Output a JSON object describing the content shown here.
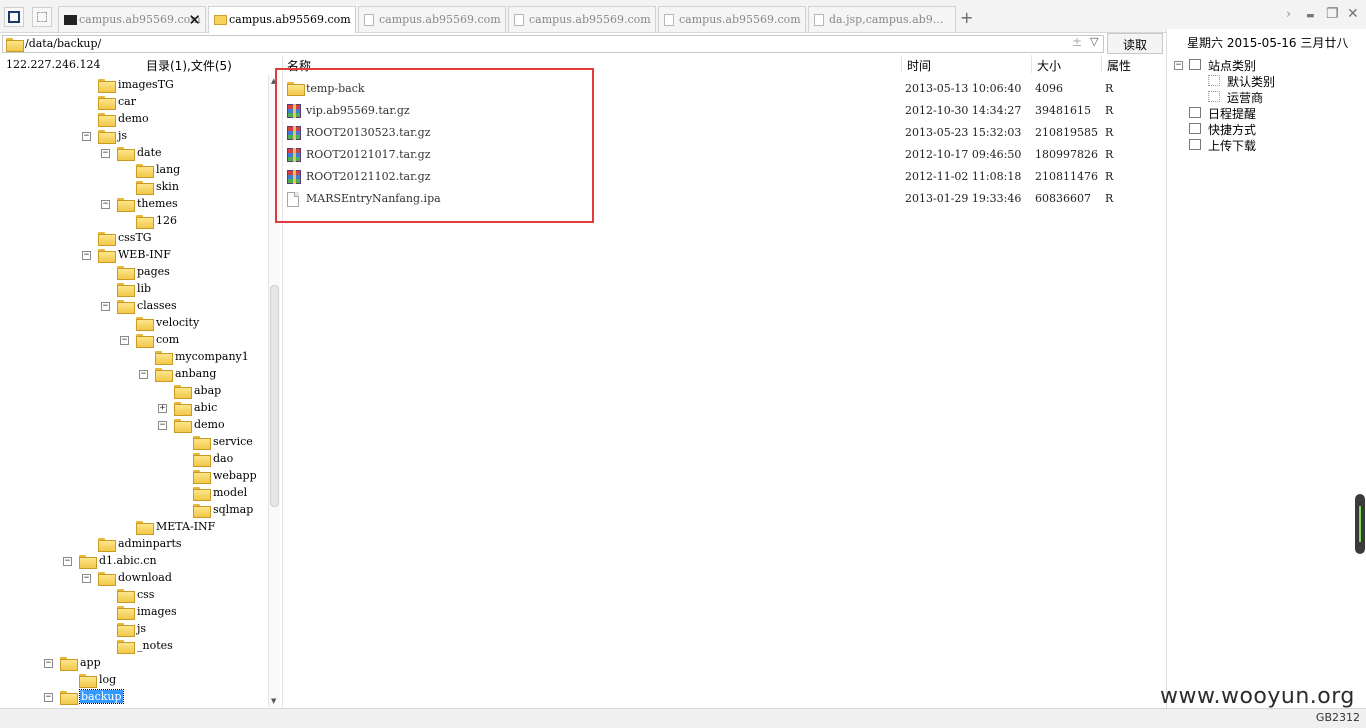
{
  "tabs": [
    {
      "label": "campus.ab95569.com",
      "icon": "terminal-icon",
      "active": false,
      "closable": true
    },
    {
      "label": "campus.ab95569.com",
      "icon": "folder-icon",
      "active": true,
      "closable": false
    },
    {
      "label": "campus.ab95569.com",
      "icon": "page-icon",
      "active": false,
      "closable": false
    },
    {
      "label": "campus.ab95569.com",
      "icon": "page-icon",
      "active": false,
      "closable": false
    },
    {
      "label": "campus.ab95569.com",
      "icon": "page-icon",
      "active": false,
      "closable": false
    },
    {
      "label": "da.jsp,campus.ab9...",
      "icon": "page-icon",
      "active": false,
      "closable": false
    }
  ],
  "tab_add": "+",
  "window_controls": {
    "minimize": "▬",
    "restore": "❐",
    "close": "✕"
  },
  "address": {
    "path": "/data/backup/",
    "read_button": "读取"
  },
  "left": {
    "ip": "122.227.246.124",
    "dir_count": "目录(1),文件(5)"
  },
  "tree": [
    {
      "label": "imagesTG",
      "level": 4,
      "exp": ""
    },
    {
      "label": "car",
      "level": 4,
      "exp": ""
    },
    {
      "label": "demo",
      "level": 4,
      "exp": ""
    },
    {
      "label": "js",
      "level": 4,
      "exp": "-"
    },
    {
      "label": "date",
      "level": 5,
      "exp": "-"
    },
    {
      "label": "lang",
      "level": 6,
      "exp": ""
    },
    {
      "label": "skin",
      "level": 6,
      "exp": ""
    },
    {
      "label": "themes",
      "level": 5,
      "exp": "-"
    },
    {
      "label": "126",
      "level": 6,
      "exp": ""
    },
    {
      "label": "cssTG",
      "level": 4,
      "exp": ""
    },
    {
      "label": "WEB-INF",
      "level": 4,
      "exp": "-"
    },
    {
      "label": "pages",
      "level": 5,
      "exp": ""
    },
    {
      "label": "lib",
      "level": 5,
      "exp": ""
    },
    {
      "label": "classes",
      "level": 5,
      "exp": "-"
    },
    {
      "label": "velocity",
      "level": 6,
      "exp": ""
    },
    {
      "label": "com",
      "level": 6,
      "exp": "-"
    },
    {
      "label": "mycompany1",
      "level": 7,
      "exp": ""
    },
    {
      "label": "anbang",
      "level": 7,
      "exp": "-"
    },
    {
      "label": "abap",
      "level": 8,
      "exp": ""
    },
    {
      "label": "abic",
      "level": 8,
      "exp": "+"
    },
    {
      "label": "demo",
      "level": 8,
      "exp": "-"
    },
    {
      "label": "service",
      "level": 9,
      "exp": ""
    },
    {
      "label": "dao",
      "level": 9,
      "exp": ""
    },
    {
      "label": "webapp",
      "level": 9,
      "exp": ""
    },
    {
      "label": "model",
      "level": 9,
      "exp": ""
    },
    {
      "label": "sqlmap",
      "level": 9,
      "exp": ""
    },
    {
      "label": "META-INF",
      "level": 6,
      "exp": ""
    },
    {
      "label": "adminparts",
      "level": 4,
      "exp": ""
    },
    {
      "label": "d1.abic.cn",
      "level": 3,
      "exp": "-"
    },
    {
      "label": "download",
      "level": 4,
      "exp": "-"
    },
    {
      "label": "css",
      "level": 5,
      "exp": ""
    },
    {
      "label": "images",
      "level": 5,
      "exp": ""
    },
    {
      "label": "js",
      "level": 5,
      "exp": ""
    },
    {
      "label": "_notes",
      "level": 5,
      "exp": ""
    },
    {
      "label": "app",
      "level": 2,
      "exp": "-"
    },
    {
      "label": "log",
      "level": 3,
      "exp": ""
    },
    {
      "label": "backup",
      "level": 2,
      "exp": "-",
      "selected": true
    }
  ],
  "columns": {
    "name": "名称",
    "time": "时间",
    "size": "大小",
    "attr": "属性"
  },
  "files": [
    {
      "name": "temp-back",
      "time": "2013-05-13 10:06:40",
      "size": "4096",
      "attr": "R",
      "type": "folder"
    },
    {
      "name": "vip.ab95569.tar.gz",
      "time": "2012-10-30 14:34:27",
      "size": "39481615",
      "attr": "R",
      "type": "archive"
    },
    {
      "name": "ROOT20130523.tar.gz",
      "time": "2013-05-23 15:32:03",
      "size": "210819585",
      "attr": "R",
      "type": "archive"
    },
    {
      "name": "ROOT20121017.tar.gz",
      "time": "2012-10-17 09:46:50",
      "size": "180997826",
      "attr": "R",
      "type": "archive"
    },
    {
      "name": "ROOT20121102.tar.gz",
      "time": "2012-11-02 11:08:18",
      "size": "210811476",
      "attr": "R",
      "type": "archive"
    },
    {
      "name": "MARSEntryNanfang.ipa",
      "time": "2013-01-29 19:33:46",
      "size": "60836607",
      "attr": "R",
      "type": "file"
    }
  ],
  "right": {
    "date": "星期六 2015-05-16 三月廿八",
    "items": [
      {
        "label": "站点类别",
        "indent": 0,
        "exp": "-",
        "icon": "category-icon"
      },
      {
        "label": "默认类别",
        "indent": 1,
        "exp": "",
        "icon": "dotted-icon"
      },
      {
        "label": "运营商",
        "indent": 1,
        "exp": "",
        "icon": "dotted-icon"
      },
      {
        "label": "日程提醒",
        "indent": 0,
        "exp": "",
        "icon": "clock-icon"
      },
      {
        "label": "快捷方式",
        "indent": 0,
        "exp": "",
        "icon": "shortcut-icon"
      },
      {
        "label": "上传下载",
        "indent": 0,
        "exp": "",
        "icon": "transfer-icon"
      }
    ]
  },
  "status": {
    "encoding": "GB2312"
  },
  "watermark": "www.wooyun.org",
  "colors": {
    "highlight": "#e23b3b",
    "selection": "#3399ff",
    "folder": "#f1c84a"
  }
}
